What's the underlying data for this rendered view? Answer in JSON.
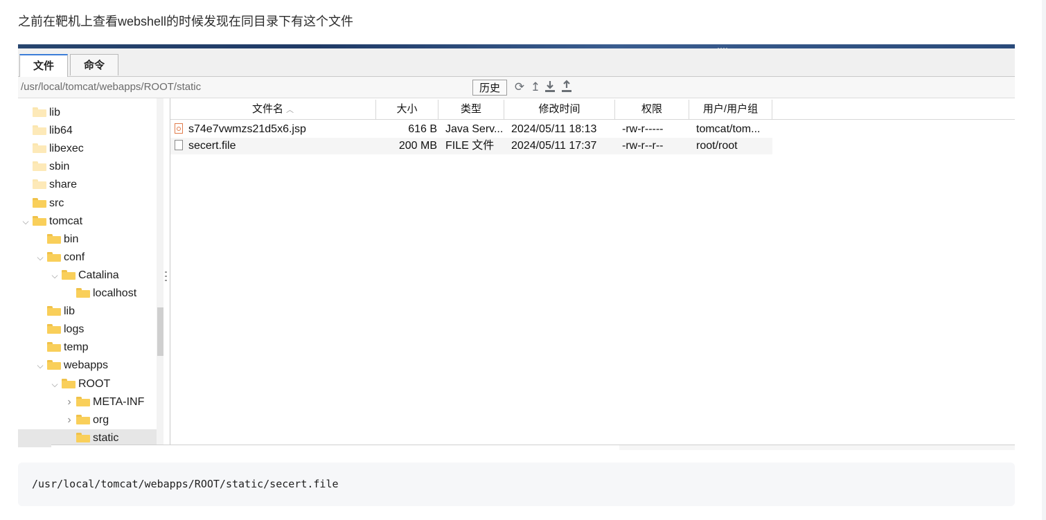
{
  "intro_text": "之前在靶机上查看webshell的时候发现在同目录下有这个文件",
  "tabs": [
    {
      "label": "文件",
      "active": true
    },
    {
      "label": "命令",
      "active": false
    }
  ],
  "path": {
    "value": "/usr/local/tomcat/webapps/ROOT/static",
    "history_label": "历史"
  },
  "toolbar_icons": [
    "refresh-icon",
    "up-dir-icon",
    "download-icon",
    "upload-icon"
  ],
  "tree": [
    {
      "label": "lib",
      "depth": 0,
      "expander": "none",
      "pale": true
    },
    {
      "label": "lib64",
      "depth": 0,
      "expander": "none",
      "pale": true
    },
    {
      "label": "libexec",
      "depth": 0,
      "expander": "none",
      "pale": true
    },
    {
      "label": "sbin",
      "depth": 0,
      "expander": "none",
      "pale": true
    },
    {
      "label": "share",
      "depth": 0,
      "expander": "none",
      "pale": true
    },
    {
      "label": "src",
      "depth": 0,
      "expander": "none"
    },
    {
      "label": "tomcat",
      "depth": 0,
      "expander": "expanded"
    },
    {
      "label": "bin",
      "depth": 1,
      "expander": "none"
    },
    {
      "label": "conf",
      "depth": 1,
      "expander": "expanded"
    },
    {
      "label": "Catalina",
      "depth": 2,
      "expander": "expanded"
    },
    {
      "label": "localhost",
      "depth": 3,
      "expander": "none"
    },
    {
      "label": "lib",
      "depth": 1,
      "expander": "none"
    },
    {
      "label": "logs",
      "depth": 1,
      "expander": "none"
    },
    {
      "label": "temp",
      "depth": 1,
      "expander": "none"
    },
    {
      "label": "webapps",
      "depth": 1,
      "expander": "expanded"
    },
    {
      "label": "ROOT",
      "depth": 2,
      "expander": "expanded"
    },
    {
      "label": "META-INF",
      "depth": 3,
      "expander": "collapsed"
    },
    {
      "label": "org",
      "depth": 3,
      "expander": "collapsed"
    },
    {
      "label": "static",
      "depth": 3,
      "expander": "none",
      "selected": true
    }
  ],
  "columns": {
    "name": "文件名",
    "size": "大小",
    "type": "类型",
    "mtime": "修改时间",
    "perm": "权限",
    "owner": "用户/用户组"
  },
  "files": [
    {
      "name": "s74e7vwmzs21d5x6.jsp",
      "size": "616 B",
      "type": "Java Serv...",
      "mtime": "2024/05/11 18:13",
      "perm": "-rw-r-----",
      "owner": "tomcat/tom...",
      "kind": "jsp"
    },
    {
      "name": "secert.file",
      "size": "200 MB",
      "type": "FILE 文件",
      "mtime": "2024/05/11 17:37",
      "perm": "-rw-r--r--",
      "owner": "root/root",
      "kind": "file"
    }
  ],
  "code_block": "/usr/local/tomcat/webapps/ROOT/static/secert.file"
}
